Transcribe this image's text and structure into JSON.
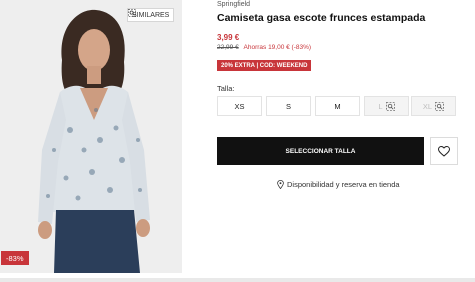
{
  "product": {
    "brand": "Springfield",
    "title": "Camiseta gasa escote frunces estampada",
    "price": "3,99 €",
    "old_price": "22,99 €",
    "now_text": "Ahorras 19,00 € (-83%)",
    "promo": "20% EXTRA | COD: WEEKEND",
    "discount_badge": "-83%",
    "similar_label": "SIMILARES"
  },
  "sizes": {
    "label": "Talla:",
    "options": [
      {
        "label": "XS",
        "available": true
      },
      {
        "label": "S",
        "available": true
      },
      {
        "label": "M",
        "available": true
      },
      {
        "label": "L",
        "available": false
      },
      {
        "label": "XL",
        "available": false
      }
    ]
  },
  "actions": {
    "select_size": "SELECCIONAR TALLA",
    "availability": "Disponibilidad y reserva en tienda"
  },
  "colors": {
    "accent_red": "#c8353a",
    "button_black": "#111111"
  },
  "icons": {
    "similar": "similar-search-icon",
    "favorite": "heart-icon",
    "location": "location-pin-icon",
    "size_alert": "similar-search-icon"
  }
}
